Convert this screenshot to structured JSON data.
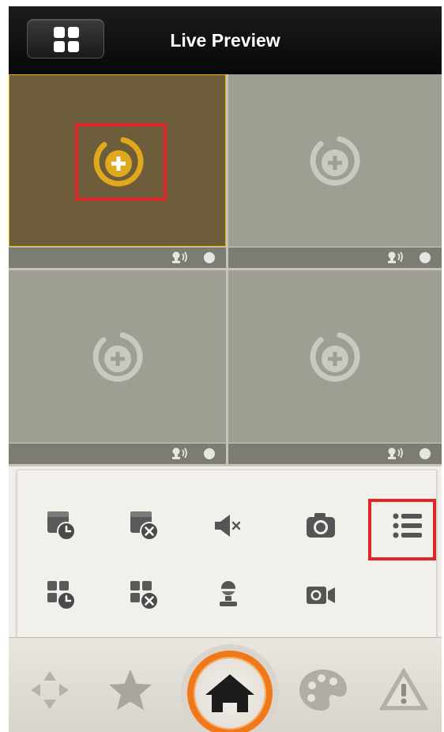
{
  "header": {
    "title": "Live Preview",
    "layout_icon": "grid-layout-icon"
  },
  "tiles": [
    {
      "id": "1",
      "state": "selected",
      "icon": "add-camera-icon"
    },
    {
      "id": "2",
      "state": "empty",
      "icon": "add-camera-icon"
    },
    {
      "id": "3",
      "state": "empty",
      "icon": "add-camera-icon"
    },
    {
      "id": "4",
      "state": "empty",
      "icon": "add-camera-icon"
    }
  ],
  "toolbar": {
    "row1": [
      "schedule-icon",
      "close-window-icon",
      "mute-icon",
      "snapshot-icon",
      "list-icon"
    ],
    "row2": [
      "schedule-all-icon",
      "close-all-icon",
      "talk-icon",
      "record-icon"
    ]
  },
  "nav": [
    "ptz-icon",
    "favorites-icon",
    "home-icon",
    "image-settings-icon",
    "alarm-icon"
  ],
  "colors": {
    "accent": "#f07818",
    "selected_tile": "#6e5d3a",
    "selected_border": "#e2b100",
    "empty_tile": "#9e9e92",
    "highlight": "#e0262a"
  }
}
